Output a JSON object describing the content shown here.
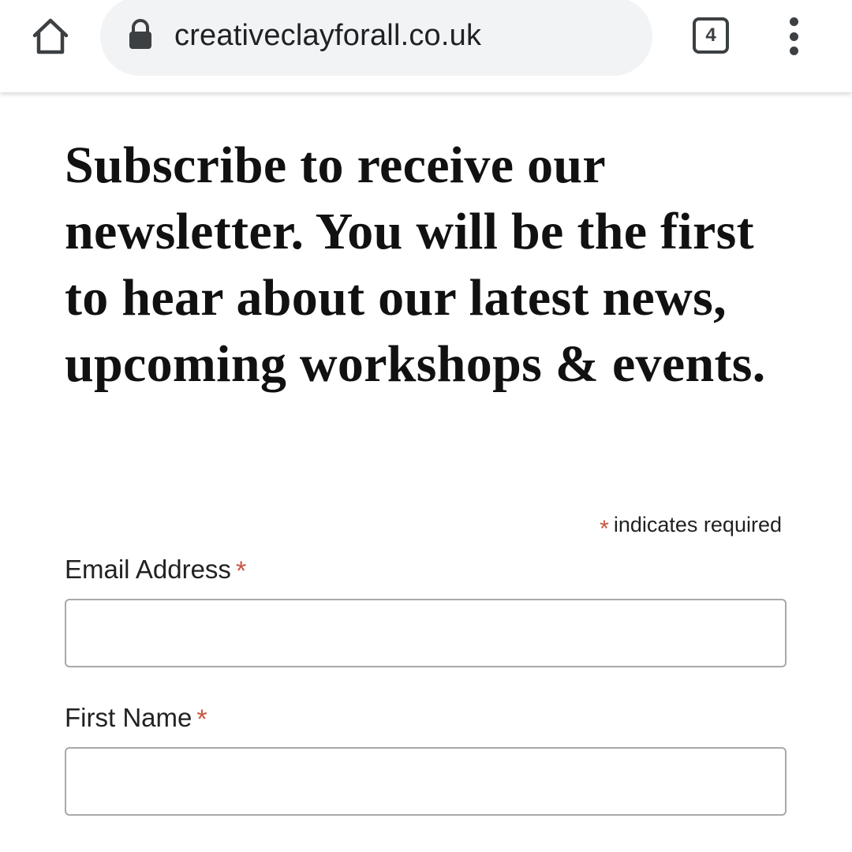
{
  "browser": {
    "url": "creativeclayforall.co.uk",
    "tab_count": "4"
  },
  "page": {
    "headline": "Subscribe to receive our newsletter. You will be the first to hear about our latest news, upcoming workshops & events.",
    "required_marker": "*",
    "required_note": "indicates required"
  },
  "form": {
    "email": {
      "label": "Email Address",
      "value": "",
      "placeholder": ""
    },
    "first_name": {
      "label": "First Name",
      "value": "",
      "placeholder": ""
    }
  },
  "colors": {
    "asterisk": "#c8553d",
    "omnibox_bg": "#f1f3f4",
    "icon": "#3c4043"
  },
  "icons": {
    "home": "home-icon",
    "lock": "lock-icon",
    "tabs": "tab-switcher-icon",
    "menu": "more-vert-icon"
  }
}
